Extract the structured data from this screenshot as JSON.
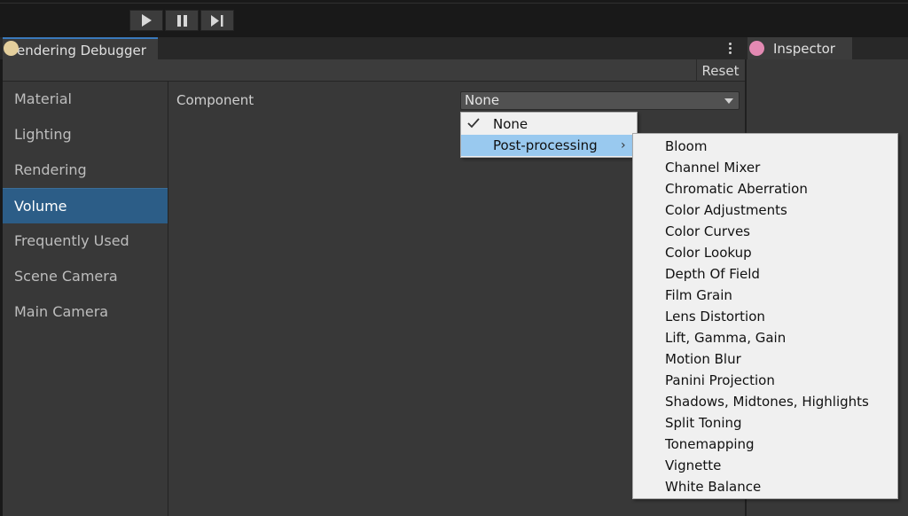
{
  "toolbar": {
    "buttons": [
      {
        "name": "play-button",
        "icon": "play-icon"
      },
      {
        "name": "pause-button",
        "icon": "pause-icon"
      },
      {
        "name": "step-button",
        "icon": "step-icon"
      }
    ]
  },
  "debugger": {
    "tab_title": "endering Debugger",
    "reset_label": "Reset",
    "accent_color": "#2c5d87"
  },
  "sidebar": {
    "items": [
      {
        "label": "Material",
        "active": false
      },
      {
        "label": "Lighting",
        "active": false
      },
      {
        "label": "Rendering",
        "active": false
      },
      {
        "label": "Volume",
        "active": true
      },
      {
        "label": "Frequently Used",
        "active": false
      },
      {
        "label": "Scene Camera",
        "active": false
      },
      {
        "label": "Main Camera",
        "active": false
      }
    ]
  },
  "main": {
    "component_label": "Component",
    "component_value": "None"
  },
  "menu": {
    "items": [
      {
        "label": "None",
        "checked": true
      },
      {
        "label": "Post-processing",
        "submenu_arrow": "›",
        "highlighted": true
      }
    ],
    "submenu": [
      "Bloom",
      "Channel Mixer",
      "Chromatic Aberration",
      "Color Adjustments",
      "Color Curves",
      "Color Lookup",
      "Depth Of Field",
      "Film Grain",
      "Lens Distortion",
      "Lift, Gamma, Gain",
      "Motion Blur",
      "Panini Projection",
      "Shadows, Midtones, Highlights",
      "Split Toning",
      "Tonemapping",
      "Vignette",
      "White Balance"
    ]
  },
  "inspector": {
    "tab_title": "Inspector"
  }
}
